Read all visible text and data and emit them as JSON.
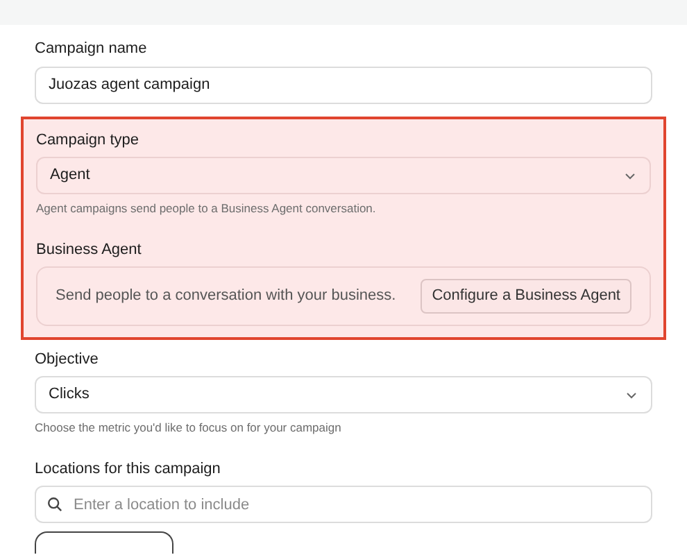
{
  "name_field": {
    "label": "Campaign name",
    "value": "Juozas agent campaign"
  },
  "highlight": {
    "campaign_type": {
      "label": "Campaign type",
      "value": "Agent",
      "help": "Agent campaigns send people to a Business Agent conversation."
    },
    "business_agent": {
      "label": "Business Agent",
      "text": "Send people to a conversation with your business.",
      "button": "Configure a Business Agent"
    }
  },
  "objective": {
    "label": "Objective",
    "value": "Clicks",
    "help": "Choose the metric you'd like to focus on for your campaign"
  },
  "locations": {
    "label": "Locations for this campaign",
    "placeholder": "Enter a location to include"
  }
}
